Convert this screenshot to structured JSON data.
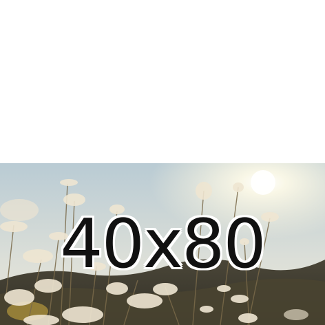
{
  "image": {
    "caption": "40x80"
  },
  "colors": {
    "sky_top": "#b9cbd4",
    "sky_bottom": "#e8e4d6",
    "sun": "#fffdf0",
    "hills": "#2a2a1e",
    "flowers": "#efe6d2",
    "stems": "#7a6a4a",
    "caption_fill": "#111111",
    "caption_outline": "#ffffff"
  }
}
